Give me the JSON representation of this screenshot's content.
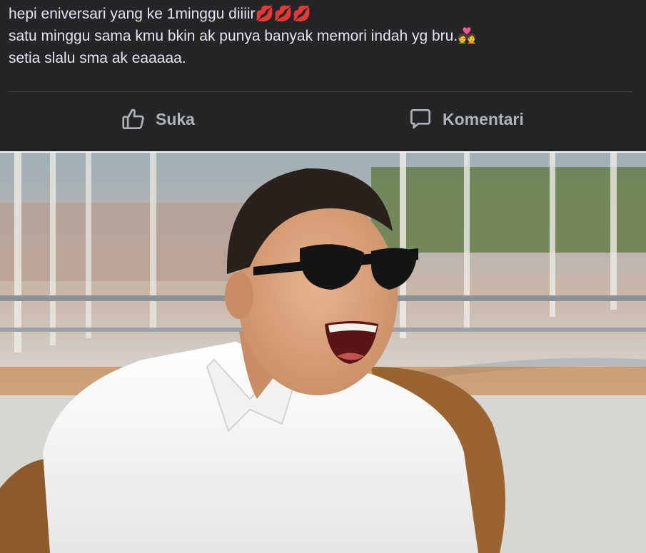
{
  "post": {
    "lines": [
      "hepi eniversari yang ke 1minggu diiiir💋💋💋",
      "satu minggu sama kmu bkin ak punya banyak memori indah yg bru.💑",
      "setia slalu sma ak eaaaaa."
    ]
  },
  "actions": {
    "like_label": "Suka",
    "like_icon": "thumbs-up-icon",
    "comment_label": "Komentari",
    "comment_icon": "speech-bubble-icon"
  },
  "colors": {
    "card_background": "#242526",
    "text": "#e4e6eb",
    "action_text": "#b0b3b8",
    "divider": "#3e4042"
  },
  "photo": {
    "subject": "laughing man in sunglasses and white shirt"
  }
}
